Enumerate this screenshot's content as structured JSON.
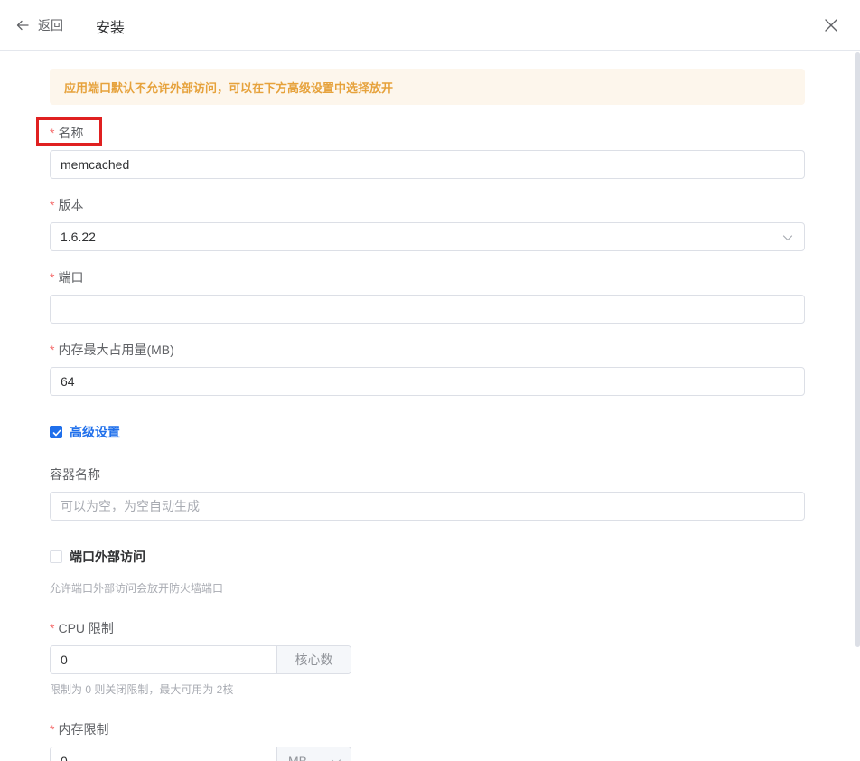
{
  "header": {
    "back_label": "返回",
    "title": "安装"
  },
  "alert": {
    "text": "应用端口默认不允许外部访问，可以在下方高级设置中选择放开"
  },
  "form": {
    "required_mark": "*",
    "name": {
      "label": "名称",
      "value": "memcached"
    },
    "version": {
      "label": "版本",
      "value": "1.6.22"
    },
    "port": {
      "label": "端口",
      "value": ""
    },
    "max_memory": {
      "label": "内存最大占用量(MB)",
      "value": "64"
    },
    "advanced": {
      "label": "高级设置",
      "checked": true
    },
    "container_name": {
      "label": "容器名称",
      "value": "",
      "placeholder": "可以为空，为空自动生成"
    },
    "port_external": {
      "label": "端口外部访问",
      "checked": false,
      "help": "允许端口外部访问会放开防火墙端口"
    },
    "cpu_limit": {
      "label": "CPU 限制",
      "value": "0",
      "unit": "核心数",
      "help": "限制为 0 则关闭限制，最大可用为 2核"
    },
    "memory_limit": {
      "label": "内存限制",
      "value": "0",
      "unit": "MB"
    }
  },
  "colors": {
    "primary": "#1f6feb",
    "warning_text": "#e6a23c",
    "warning_bg": "#fdf6ec",
    "required": "#f56c6c",
    "highlight": "#e02020"
  },
  "icons": {
    "back": "arrow-left-icon",
    "close": "close-icon",
    "select": "chevron-down-icon",
    "check": "check-icon"
  }
}
